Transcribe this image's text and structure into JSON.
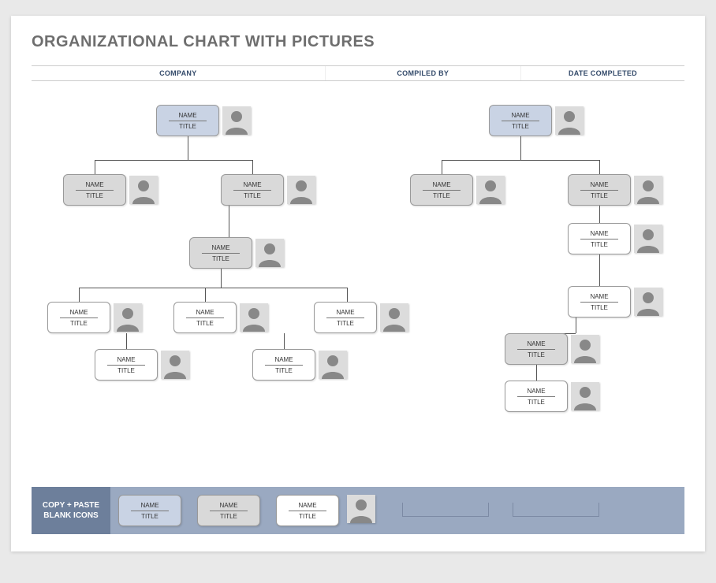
{
  "header": {
    "title": "ORGANIZATIONAL CHART WITH PICTURES",
    "meta": {
      "company": "COMPANY",
      "compiled_by": "COMPILED BY",
      "date_completed": "DATE COMPLETED"
    }
  },
  "labels": {
    "name": "NAME",
    "title": "TITLE"
  },
  "footer": {
    "label_line1": "COPY + PASTE",
    "label_line2": "BLANK ICONS",
    "samples": [
      {
        "name": "NAME",
        "title": "TITLE",
        "style": "blue"
      },
      {
        "name": "NAME",
        "title": "TITLE",
        "style": "grey"
      },
      {
        "name": "NAME",
        "title": "TITLE",
        "style": "white"
      }
    ]
  },
  "nodes": {
    "topA": {
      "name": "NAME",
      "title": "TITLE",
      "style": "blue"
    },
    "a1": {
      "name": "NAME",
      "title": "TITLE",
      "style": "grey"
    },
    "a2": {
      "name": "NAME",
      "title": "TITLE",
      "style": "grey"
    },
    "a2c": {
      "name": "NAME",
      "title": "TITLE",
      "style": "grey"
    },
    "g1": {
      "name": "NAME",
      "title": "TITLE",
      "style": "white"
    },
    "g2": {
      "name": "NAME",
      "title": "TITLE",
      "style": "white"
    },
    "g3": {
      "name": "NAME",
      "title": "TITLE",
      "style": "white"
    },
    "g4": {
      "name": "NAME",
      "title": "TITLE",
      "style": "white"
    },
    "g5": {
      "name": "NAME",
      "title": "TITLE",
      "style": "white"
    },
    "topB": {
      "name": "NAME",
      "title": "TITLE",
      "style": "blue"
    },
    "b1": {
      "name": "NAME",
      "title": "TITLE",
      "style": "grey"
    },
    "b2": {
      "name": "NAME",
      "title": "TITLE",
      "style": "grey"
    },
    "b2a": {
      "name": "NAME",
      "title": "TITLE",
      "style": "white"
    },
    "b2b": {
      "name": "NAME",
      "title": "TITLE",
      "style": "white"
    },
    "b2c": {
      "name": "NAME",
      "title": "TITLE",
      "style": "grey"
    },
    "b2d": {
      "name": "NAME",
      "title": "TITLE",
      "style": "white"
    }
  }
}
